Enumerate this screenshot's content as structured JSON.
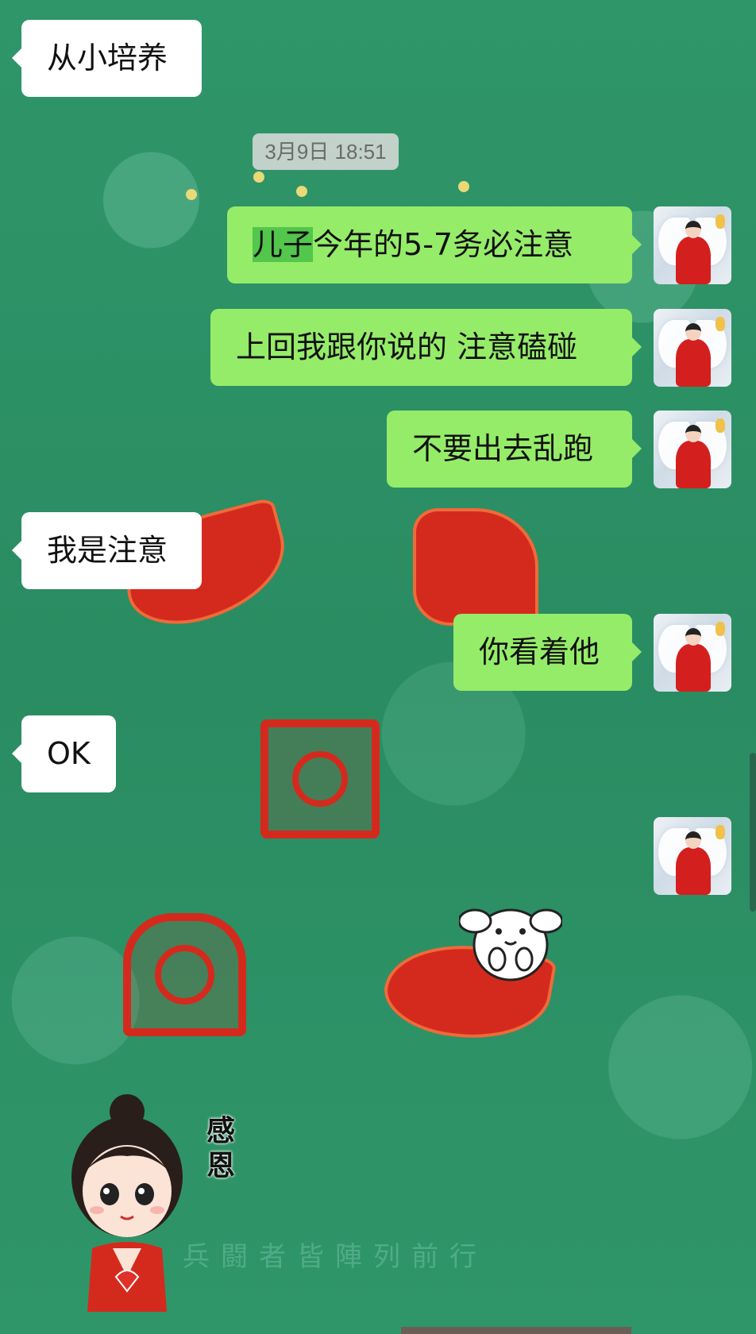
{
  "timestamp": "3月9日 18:51",
  "messages": [
    {
      "side": "in",
      "text": "从小培养"
    },
    {
      "side": "out",
      "highlight": "儿子",
      "text": "今年的5-7务必注意"
    },
    {
      "side": "out",
      "text": "上回我跟你说的 注意磕碰"
    },
    {
      "side": "out",
      "text": "不要出去乱跑"
    },
    {
      "side": "in",
      "text": "我是注意"
    },
    {
      "side": "out",
      "text": "你看着他"
    },
    {
      "side": "in",
      "text": "OK"
    },
    {
      "side": "out",
      "sticker": "white-dog-sticker"
    },
    {
      "side": "in",
      "sticker": "girl-heart-sticker",
      "sticker_text": "感恩"
    }
  ],
  "wallpaper": {
    "motto": "兵闘者皆陣列前行"
  },
  "colors": {
    "wallpaper": "#2e9468",
    "incoming_bubble": "#ffffff",
    "outgoing_bubble": "#95ec69",
    "highlight": "#53c64c",
    "timestamp_bg": "#dcdcdc",
    "seal_red": "#d42a1e"
  }
}
